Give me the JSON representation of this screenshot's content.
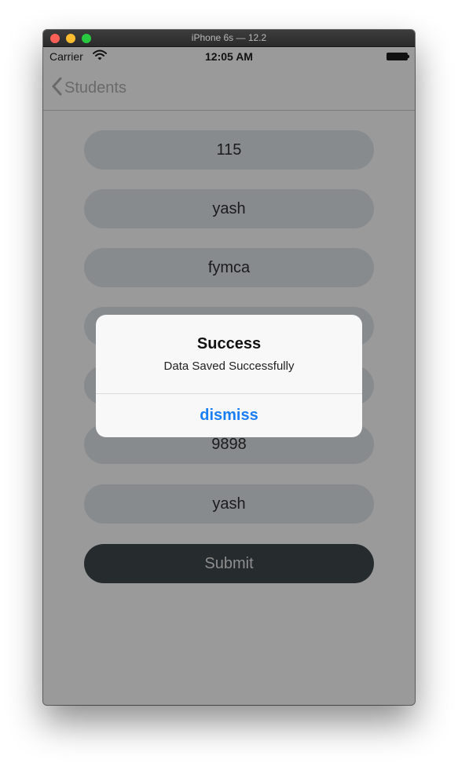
{
  "window": {
    "title": "iPhone 6s — 12.2"
  },
  "status_bar": {
    "carrier": "Carrier",
    "time": "12:05 AM"
  },
  "nav": {
    "back_label": "Students"
  },
  "form": {
    "fields": [
      {
        "value": "115"
      },
      {
        "value": "yash"
      },
      {
        "value": "fymca"
      },
      {
        "value": ""
      },
      {
        "value": ""
      },
      {
        "value": "9898"
      },
      {
        "value": "yash"
      }
    ],
    "submit_label": "Submit"
  },
  "alert": {
    "title": "Success",
    "message": "Data Saved Successfully",
    "button_label": "dismiss"
  },
  "colors": {
    "accent": "#1a7ef7",
    "overlay": "#9a9a9a",
    "submit_bg": "#262b2e"
  }
}
